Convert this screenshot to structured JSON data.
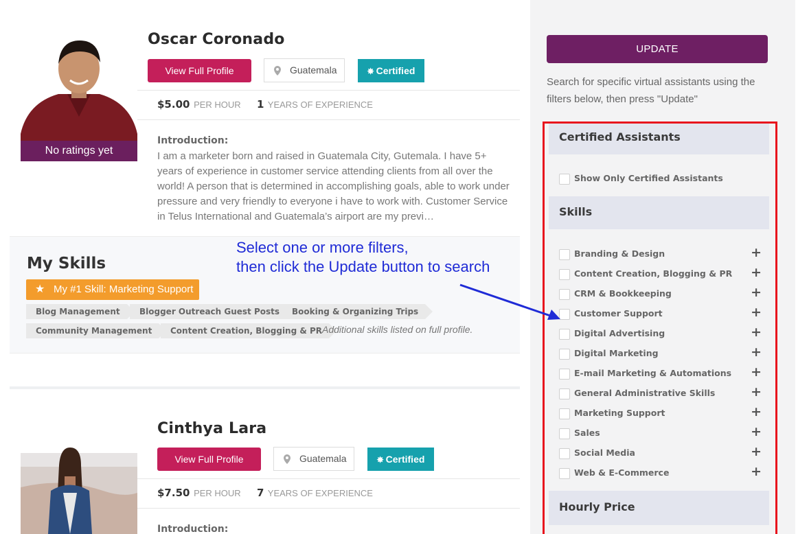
{
  "profiles": [
    {
      "name": "Oscar Coronado",
      "view_label": "View Full Profile",
      "location": "Guatemala",
      "certified_label": "Certified",
      "rate": "$5.00",
      "rate_unit": "PER HOUR",
      "years": "1",
      "years_label": "YEARS OF EXPERIENCE",
      "rating_text": "No ratings yet",
      "intro_label": "Introduction:",
      "intro_text": "I am a marketer born and raised in Guatemala City, Gutemala. I have 5+ years of experience in customer service attending clients from all over the world! A person that is determined in accomplishing goals, able to work under pressure and very friendly to everyone i have to work with. Customer Service in Telus International and Guatemala’s airport are my previ…"
    },
    {
      "name": "Cinthya Lara",
      "view_label": "View Full Profile",
      "location": "Guatemala",
      "certified_label": "Certified",
      "rate": "$7.50",
      "rate_unit": "PER HOUR",
      "years": "7",
      "years_label": "YEARS OF EXPERIENCE",
      "intro_label": "Introduction:"
    }
  ],
  "skills": {
    "title": "My Skills",
    "top_skill": "My #1 Skill: Marketing Support",
    "tags": [
      "Blog Management",
      "Blogger Outreach Guest Posts",
      "Booking & Organizing Trips",
      "Community Management",
      "Content Creation, Blogging & PR"
    ],
    "more_note": "Additional skills listed on full profile."
  },
  "annotation": {
    "line1": "Select one or more filters,",
    "line2": "then click the Update button to search",
    "color": "#1f2bd6"
  },
  "sidebar": {
    "update_label": "UPDATE",
    "help_text": "Search for specific virtual assistants using the filters below, then press \"Update\"",
    "certified_section": "Certified Assistants",
    "certified_option": "Show Only Certified Assistants",
    "skills_section": "Skills",
    "skill_filters": [
      "Branding & Design",
      "Content Creation, Blogging & PR",
      "CRM & Bookkeeping",
      "Customer Support",
      "Digital Advertising",
      "Digital Marketing",
      "E-mail Marketing & Automations",
      "General Administrative Skills",
      "Marketing Support",
      "Sales",
      "Social Media",
      "Web & E-Commerce"
    ],
    "price_section": "Hourly Price"
  },
  "colors": {
    "profile_button": "#c41f5a",
    "certified": "#16a1ad",
    "update_button": "#6e1f63",
    "top_skill": "#f39c2c",
    "highlight_box": "#e8141d"
  },
  "icons": {
    "location": "map-pin-icon",
    "certified": "badge-icon",
    "star": "star-icon",
    "expand": "plus-icon"
  }
}
